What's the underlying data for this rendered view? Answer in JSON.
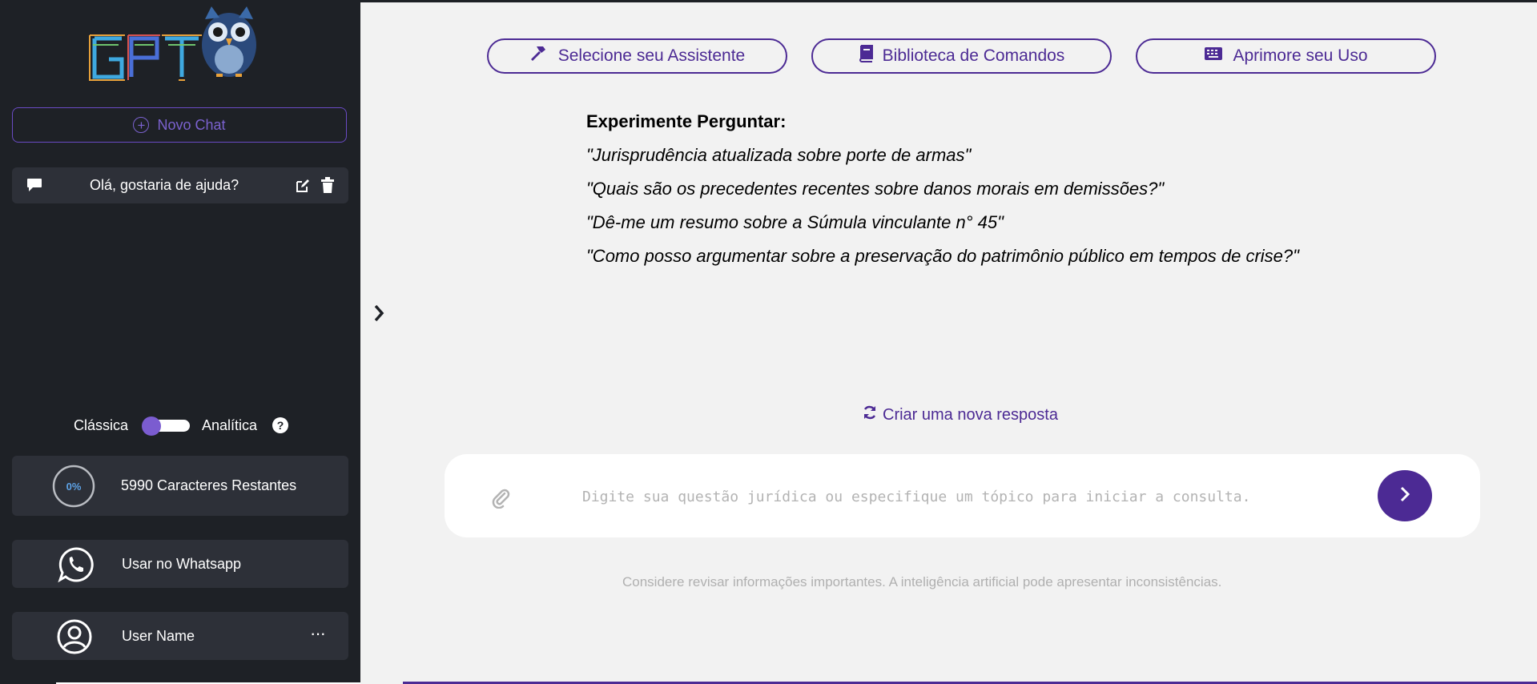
{
  "colors": {
    "sidebar_bg": "#1e2126",
    "card_bg": "#2d3038",
    "accent": "#4c2a94",
    "accent_light": "#7b62cf",
    "main_bg": "#f2f2f2"
  },
  "sidebar": {
    "logo_text": "GPT",
    "new_chat_label": "Novo Chat",
    "chats": [
      {
        "title": "Olá, gostaria de ajuda?"
      }
    ],
    "mode": {
      "left_label": "Clássica",
      "right_label": "Analítica",
      "help": "?"
    },
    "characters": {
      "percent_label": "0%",
      "progress": 0,
      "text": "5990 Caracteres Restantes"
    },
    "whatsapp_label": "Usar no Whatsapp",
    "user": {
      "name": "User Name",
      "more": "···"
    }
  },
  "toolbar": {
    "assistant_label": "Selecione seu Assistente",
    "library_label": "Biblioteca de Comandos",
    "improve_label": "Aprimore seu Uso"
  },
  "suggestions": {
    "heading": "Experimente Perguntar:",
    "items": [
      "\"Jurisprudência atualizada sobre porte de armas\"",
      "\"Quais são os precedentes recentes sobre danos morais em demissões?\"",
      "\"Dê-me um resumo sobre a Súmula vinculante n° 45\"",
      "\"Como posso argumentar sobre a preservação do patrimônio público em tempos de crise?\""
    ]
  },
  "regenerate_label": "Criar uma nova resposta",
  "input": {
    "placeholder": "Digite sua questão jurídica ou especifique um tópico para iniciar a consulta.",
    "value": ""
  },
  "disclaimer": "Considere revisar informações importantes. A inteligência artificial pode apresentar inconsistências.",
  "icons": {
    "new_chat": "plus-circle-icon",
    "chat": "comment-icon",
    "edit": "edit-icon",
    "delete": "trash-icon",
    "whatsapp": "whatsapp-icon",
    "user": "user-circle-icon",
    "assistant": "hammer-icon",
    "library": "book-icon",
    "improve": "keyboard-icon",
    "regenerate": "refresh-icon",
    "attach": "paperclip-icon",
    "send": "chevron-right-icon"
  }
}
